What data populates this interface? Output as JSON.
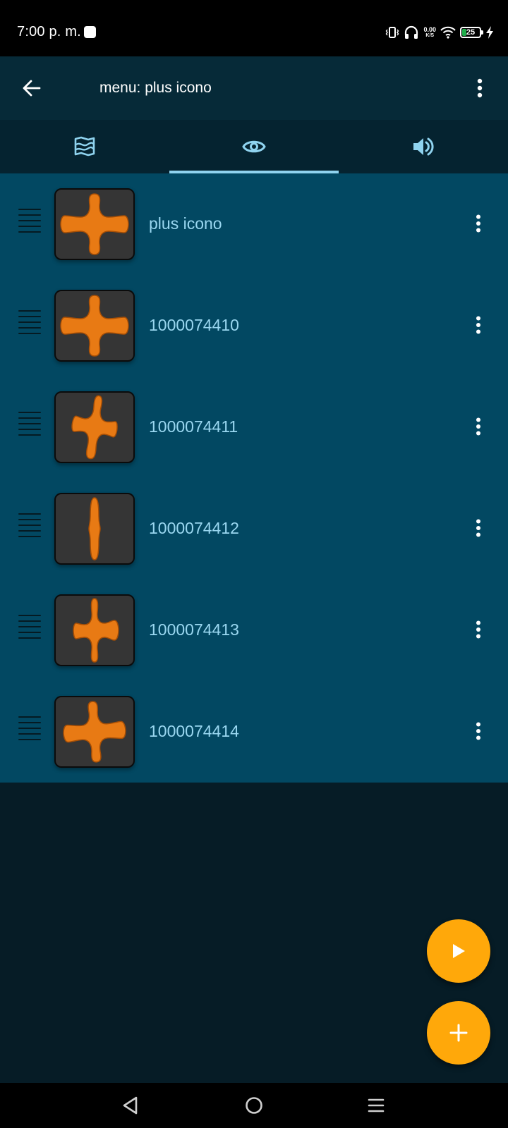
{
  "status_bar": {
    "time": "7:00 p. m.",
    "net_speed_value": "0.00",
    "net_speed_unit": "K/S",
    "battery_level": "25",
    "battery_fraction": 0.25,
    "icons": [
      "vibrate-icon",
      "headphones-icon",
      "wifi-icon",
      "battery-icon",
      "charging-icon"
    ]
  },
  "app_bar": {
    "title": "menu: plus icono",
    "back_icon": "arrow-left-icon",
    "menu_icon": "more-vertical-icon"
  },
  "tabs": [
    {
      "icon": "map-icon",
      "selected": false
    },
    {
      "icon": "eye-icon",
      "selected": true
    },
    {
      "icon": "volume-icon",
      "selected": false
    }
  ],
  "list": {
    "items": [
      {
        "label": "plus icono"
      },
      {
        "label": "1000074410"
      },
      {
        "label": "1000074411"
      },
      {
        "label": "1000074412"
      },
      {
        "label": "1000074413"
      },
      {
        "label": "1000074414"
      }
    ]
  },
  "fabs": {
    "play_icon": "play-icon",
    "add_icon": "plus-icon"
  },
  "nav_bar": {
    "icons": [
      "back-triangle-icon",
      "home-circle-icon",
      "recents-menu-icon"
    ]
  },
  "colors": {
    "list_background": "#024862",
    "app_bar": "#062a38",
    "tab_bar": "#052330",
    "page_background": "#061c26",
    "accent": "#ffa80a",
    "item_text": "#9ad7f0",
    "tab_active": "#8fd3ef",
    "cross_orange": "#e87a14"
  }
}
